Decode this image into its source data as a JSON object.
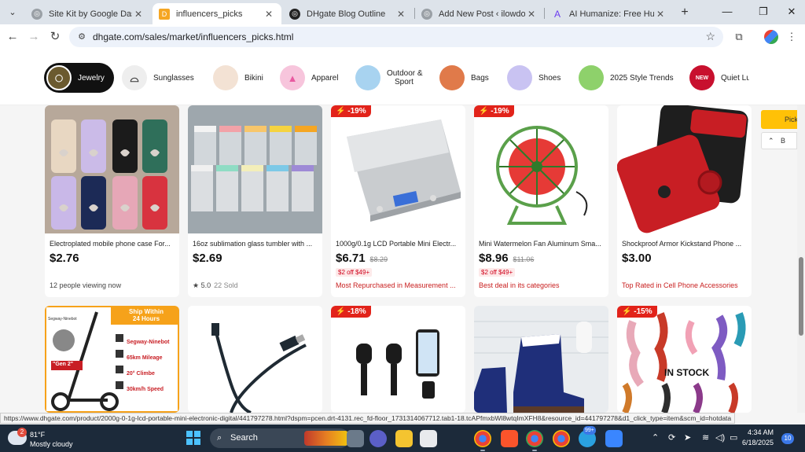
{
  "browser": {
    "tabs": [
      {
        "title": "Site Kit by Google Dashboard",
        "active": false
      },
      {
        "title": "influencers_picks",
        "active": true
      },
      {
        "title": "DHgate Blog Outline",
        "active": false
      },
      {
        "title": "Add New Post ‹ ilowdo — W",
        "active": false
      },
      {
        "title": "AI Humanize: Free Humaniz",
        "active": false
      }
    ],
    "url": "dhgate.com/sales/market/influencers_picks.html",
    "status_url": "https://www.dhgate.com/product/2000g-0-1g-lcd-portable-mini-electronic-digital/441797278.html?dspm=pcen.drt-4131.rec_fd-floor_1731314067712.tab1-18.tcAPfmxbWl8wtqImXFH8&resource_id=441797278&d1_click_type=item&scm_id=hotdata"
  },
  "categories": [
    {
      "label": "Jewelry",
      "active": true
    },
    {
      "label": "Sunglasses"
    },
    {
      "label": "Bikini"
    },
    {
      "label": "Apparel"
    },
    {
      "label": "Outdoor &",
      "label2": "Sport"
    },
    {
      "label": "Bags"
    },
    {
      "label": "Shoes"
    },
    {
      "label": "2025 Style Trends"
    },
    {
      "label": "Quiet Lux"
    }
  ],
  "products_row1": [
    {
      "title": "Electroplated mobile phone case For...",
      "price": "$2.76",
      "meta": "12 people viewing now"
    },
    {
      "title": "16oz sublimation glass tumbler with ...",
      "price": "$2.69",
      "rating": "5.0",
      "sold": "22 Sold"
    },
    {
      "title": "1000g/0.1g LCD Portable Mini Electr...",
      "price": "$6.71",
      "old_price": "$8.29",
      "promo": "$2 off $49+",
      "meta": "Most Repurchased in Measurement ...",
      "discount": "-19%"
    },
    {
      "title": "Mini Watermelon Fan Aluminum Sma...",
      "price": "$8.96",
      "old_price": "$11.06",
      "promo": "$2 off $49+",
      "meta": "Best deal in its categories",
      "discount": "-19%"
    },
    {
      "title": "Shockproof Armor Kickstand Phone ...",
      "price": "$3.00",
      "meta": "Top Rated in Cell Phone Accessories"
    }
  ],
  "products_row2": [
    {
      "banner_line1": "Ship Within",
      "banner_line2": "24 Hours",
      "brand": "Segway-Ninebot",
      "model": "\"Gen 2\"",
      "specs": [
        "Segway-Ninebot",
        "65km Mileage",
        "20° Climbe",
        "30km/h Speed"
      ]
    },
    {},
    {
      "discount": "-18%"
    },
    {},
    {
      "discount": "-15%",
      "stock_text": "IN STOCK"
    }
  ],
  "side": {
    "pick_label": "Pick",
    "back_label": "B"
  },
  "taskbar": {
    "temp": "81°F",
    "weather": "Mostly cloudy",
    "weather_badge": "2",
    "search_placeholder": "Search",
    "time": "4:34 AM",
    "date": "6/18/2025",
    "notif_count": "10",
    "app_badge": "99+"
  },
  "colors": {
    "accent_red": "#e2231a",
    "pick_yellow": "#ffc107",
    "taskbar": "#1c2a3a"
  }
}
